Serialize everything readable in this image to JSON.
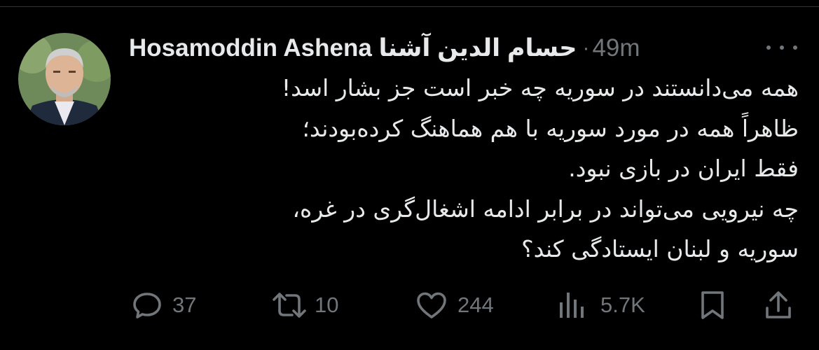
{
  "tweet": {
    "author_name": "Hosamoddin Ashena حسام الدين آشنا",
    "separator": "·",
    "timestamp": "49m",
    "lines": [
      "همه می‌دانستند در سوریه چه خبر است جز بشار اسد!",
      "ظاهراً همه در مورد سوریه با هم هماهنگ کرده‌بودند؛",
      "فقط ایران در بازی نبود.",
      "چه نیرویی می‌تواند در برابر  ادامه اشغال‌گری در غره،",
      "سوریه و لبنان ایستادگی کند؟"
    ]
  },
  "actions": {
    "replies": "37",
    "retweets": "10",
    "likes": "244",
    "views": "5.7K"
  },
  "icons": [
    "more-icon",
    "reply-icon",
    "retweet-icon",
    "like-icon",
    "views-icon",
    "bookmark-icon",
    "share-icon"
  ],
  "colors": {
    "background": "#000000",
    "text": "#e7e9ea",
    "muted": "#71767b",
    "divider": "#2f3336"
  }
}
